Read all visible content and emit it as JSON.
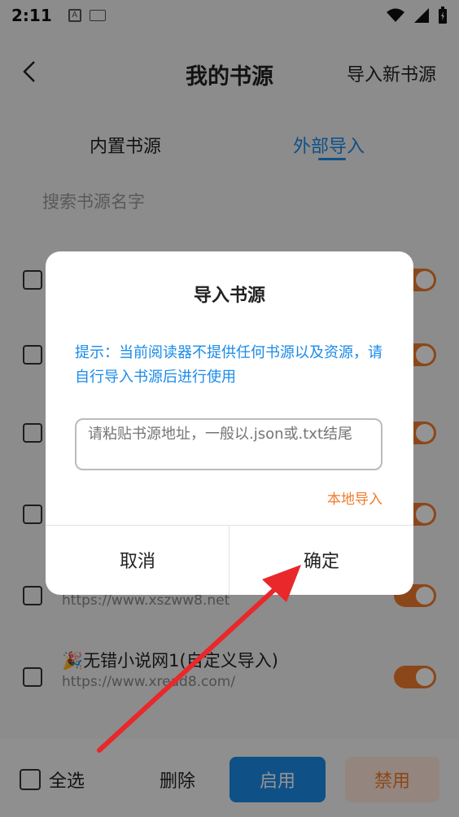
{
  "status_bar": {
    "time": "2:11",
    "icons": [
      "a-notification-icon",
      "keyboard-icon",
      "wifi-icon",
      "signal-icon",
      "battery-icon"
    ]
  },
  "app_bar": {
    "title": "我的书源",
    "action": "导入新书源",
    "back_icon": "back-arrow-icon"
  },
  "tabs": [
    {
      "label": "内置书源",
      "active": false
    },
    {
      "label": "外部导入",
      "active": true
    }
  ],
  "search": {
    "placeholder": "搜索书源名字"
  },
  "list": {
    "items": [
      {
        "name": "",
        "url": "",
        "enabled": true
      },
      {
        "name": "",
        "url": "",
        "enabled": true
      },
      {
        "name": "",
        "url": "",
        "enabled": true
      },
      {
        "name": "",
        "url": "",
        "enabled": true
      },
      {
        "name": "",
        "url": "https://www.xszww8.net",
        "enabled": true
      },
      {
        "name": "🎉无错小说网1(自定义导入)",
        "url": "https://www.xread8.com/",
        "enabled": true
      }
    ]
  },
  "bottom_bar": {
    "select_all": "全选",
    "delete": "删除",
    "enable": "启用",
    "disable": "禁用"
  },
  "dialog": {
    "title": "导入书源",
    "hint": "提示：当前阅读器不提供任何书源以及资源，请自行导入书源后进行使用",
    "input_placeholder": "请粘贴书源地址，一般以.json或.txt结尾",
    "local_import": "本地导入",
    "cancel": "取消",
    "confirm": "确定"
  },
  "colors": {
    "accent": "#1a8be8",
    "orange": "#f07b2b",
    "arrow": "#e8282b"
  }
}
